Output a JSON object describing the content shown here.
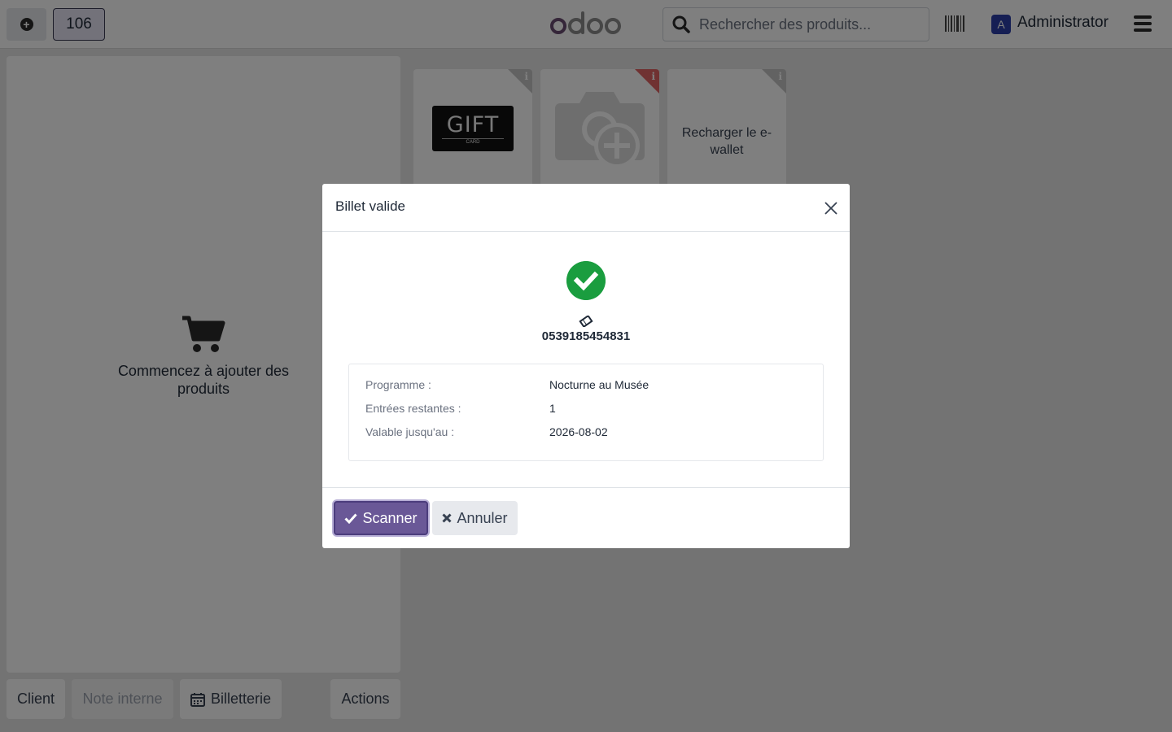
{
  "topbar": {
    "plus_icon": "plus-circle-icon",
    "order_number": "106",
    "logo_text": "odoo",
    "search_placeholder": "Rechercher des produits...",
    "barcode_icon": "barcode-icon",
    "avatar_letter": "A",
    "user_name": "Administrator",
    "menu_icon": "hamburger-icon"
  },
  "cart": {
    "icon": "shopping-cart-icon",
    "empty_text": "Commencez à ajouter des produits"
  },
  "bottom_bar": {
    "client": "Client",
    "note": "Note interne",
    "billetterie": "Billetterie",
    "billetterie_icon": "calendar-icon",
    "actions": "Actions"
  },
  "products": [
    {
      "name": "Gift Card",
      "image_text": "GIFT",
      "image_subtext": "CARD",
      "info_icon": "info-icon"
    },
    {
      "name": "",
      "image": "camera-plus-icon",
      "info_icon": "info-icon"
    },
    {
      "name": "Recharger le e-wallet",
      "info_icon": "info-icon"
    }
  ],
  "modal": {
    "title": "Billet valide",
    "close_icon": "close-icon",
    "status_icon": "check-circle-icon",
    "ticket_icon": "ticket-icon",
    "ticket_code": "0539185454831",
    "details": [
      {
        "label": "Programme :",
        "value": "Nocturne au Musée"
      },
      {
        "label": "Entrées restantes :",
        "value": "1"
      },
      {
        "label": "Valable jusqu'au :",
        "value": "2026-08-02"
      }
    ],
    "scan_button": "Scanner",
    "cancel_button": "Annuler"
  },
  "colors": {
    "primary": "#6a5897",
    "success": "#1a9d3f",
    "avatar": "#2c3ea8"
  }
}
